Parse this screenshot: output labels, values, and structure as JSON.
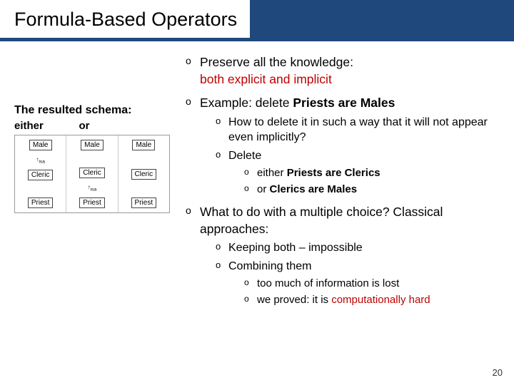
{
  "title": "Formula-Based Operators",
  "page_number": "20",
  "left": {
    "heading": "The resulted schema:",
    "label_either": "either",
    "label_or": "or",
    "nodes": {
      "male": "Male",
      "cleric": "Cleric",
      "priest": "Priest"
    },
    "isa": "isa",
    "arrow": "↑"
  },
  "bullets": {
    "preserve_a": "Preserve all the knowledge:",
    "preserve_b": "both explicit and implicit",
    "example_pre": "Example: delete ",
    "example_bold": "Priests are Males",
    "howdelete": "How to delete it in such a way that it will not appear even implicitly?",
    "delete": "Delete",
    "del_opt1_pre": "either ",
    "del_opt1_bold": "Priests are Clerics",
    "del_opt2_pre": "or ",
    "del_opt2_bold": "Clerics are Males",
    "whattodo": "What to do with a multiple choice? Classical approaches:",
    "keepboth": "Keeping both – impossible",
    "combining": "Combining them",
    "toomuch": "too much of information is lost",
    "proved_pre": "we proved: it is ",
    "proved_red": "computationally hard"
  }
}
